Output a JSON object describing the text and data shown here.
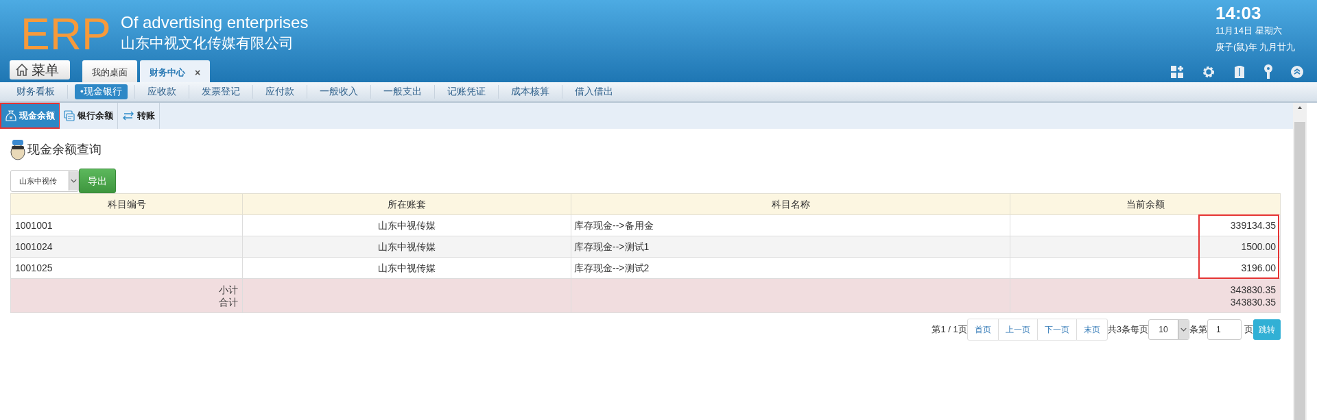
{
  "header": {
    "logo": "ERP",
    "title": "Of advertising enterprises",
    "company": "山东中视文化传媒有限公司",
    "time": "14:03",
    "date": "11月14日 星期六",
    "lunar_date": "庚子(鼠)年 九月廿九",
    "menu_button": "菜单"
  },
  "tabs": [
    {
      "label": "我的桌面",
      "selected": false
    },
    {
      "label": "财务中心",
      "selected": true,
      "close": "×"
    }
  ],
  "nav": [
    {
      "label": "财务看板",
      "selected": false
    },
    {
      "label": "•现金银行",
      "selected": true
    },
    {
      "label": "应收款",
      "selected": false
    },
    {
      "label": "发票登记",
      "selected": false
    },
    {
      "label": "应付款",
      "selected": false
    },
    {
      "label": "一般收入",
      "selected": false
    },
    {
      "label": "一般支出",
      "selected": false
    },
    {
      "label": "记账凭证",
      "selected": false
    },
    {
      "label": "成本核算",
      "selected": false
    },
    {
      "label": "借入借出",
      "selected": false
    }
  ],
  "subtabs": [
    {
      "label": "现金余额",
      "selected": true
    },
    {
      "label": "银行余额",
      "selected": false
    },
    {
      "label": "转账",
      "selected": false
    }
  ],
  "page_title": "现金余额查询",
  "filter": {
    "company": "山东中视传",
    "export": "导出"
  },
  "table": {
    "columns": [
      "科目编号",
      "所在账套",
      "科目名称",
      "当前余额"
    ],
    "rows": [
      {
        "code": "1001001",
        "book": "山东中视传媒",
        "name": "库存现金-->备用金",
        "balance": "339134.35"
      },
      {
        "code": "1001024",
        "book": "山东中视传媒",
        "name": "库存现金-->测试1",
        "balance": "1500.00"
      },
      {
        "code": "1001025",
        "book": "山东中视传媒",
        "name": "库存现金-->测试2",
        "balance": "3196.00"
      }
    ],
    "balance_highlight": true,
    "footer": {
      "labels": [
        "小计",
        "合计"
      ],
      "values": [
        "343830.35",
        "343830.35"
      ]
    }
  },
  "pagination": {
    "page_info": "第1 / 1页",
    "buttons": [
      "首页",
      "上一页",
      "下一页",
      "末页"
    ],
    "total": "共3条每页",
    "page_size": "10",
    "rows_label": "条第",
    "page": "1",
    "page_label": "页",
    "go": "跳转"
  }
}
